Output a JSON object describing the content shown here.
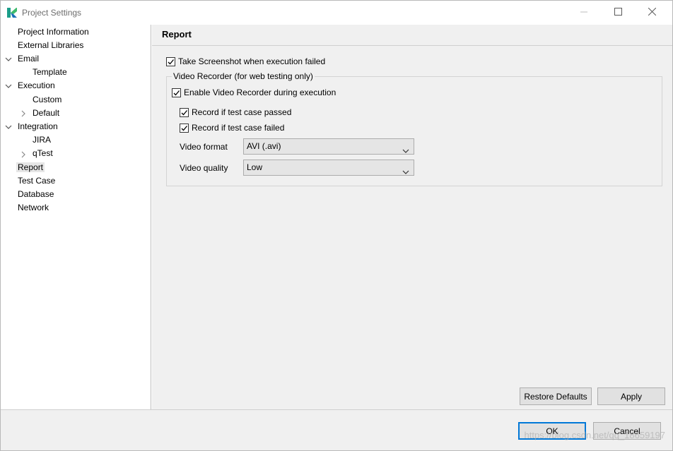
{
  "window": {
    "title": "Project Settings",
    "icon": "katalon-logo",
    "controls": [
      "minimize-icon",
      "maximize-icon",
      "close-icon"
    ]
  },
  "sidebar": {
    "items": [
      {
        "label": "Project Information",
        "level": 0,
        "expander": "none"
      },
      {
        "label": "External Libraries",
        "level": 0,
        "expander": "none"
      },
      {
        "label": "Email",
        "level": 0,
        "expander": "expanded"
      },
      {
        "label": "Template",
        "level": 1,
        "expander": "none"
      },
      {
        "label": "Execution",
        "level": 0,
        "expander": "expanded"
      },
      {
        "label": "Custom",
        "level": 1,
        "expander": "none"
      },
      {
        "label": "Default",
        "level": 1,
        "expander": "collapsed"
      },
      {
        "label": "Integration",
        "level": 0,
        "expander": "expanded"
      },
      {
        "label": "JIRA",
        "level": 1,
        "expander": "none"
      },
      {
        "label": "qTest",
        "level": 1,
        "expander": "collapsed"
      },
      {
        "label": "Report",
        "level": 0,
        "expander": "none",
        "selected": true
      },
      {
        "label": "Test Case",
        "level": 0,
        "expander": "none"
      },
      {
        "label": "Database",
        "level": 0,
        "expander": "none"
      },
      {
        "label": "Network",
        "level": 0,
        "expander": "none"
      }
    ]
  },
  "main": {
    "title": "Report",
    "take_screenshot": {
      "label": "Take Screenshot when execution failed",
      "checked": true
    },
    "video_recorder": {
      "legend": "Video Recorder (for web testing only)",
      "enable": {
        "label": "Enable Video Recorder during execution",
        "checked": true
      },
      "record_passed": {
        "label": "Record if test case passed",
        "checked": true
      },
      "record_failed": {
        "label": "Record if test case failed",
        "checked": true
      },
      "format": {
        "label": "Video format",
        "value": "AVI (.avi)"
      },
      "quality": {
        "label": "Video quality",
        "value": "Low"
      }
    },
    "buttons": {
      "restore_defaults": "Restore Defaults",
      "apply": "Apply"
    }
  },
  "footer": {
    "ok": "OK",
    "cancel": "Cancel",
    "watermark": "https://blog.csdn.net/qq_18659197"
  },
  "colors": {
    "accent": "#0078d7",
    "panel": "#f0f0f0",
    "selection": "#e6e6e6"
  }
}
